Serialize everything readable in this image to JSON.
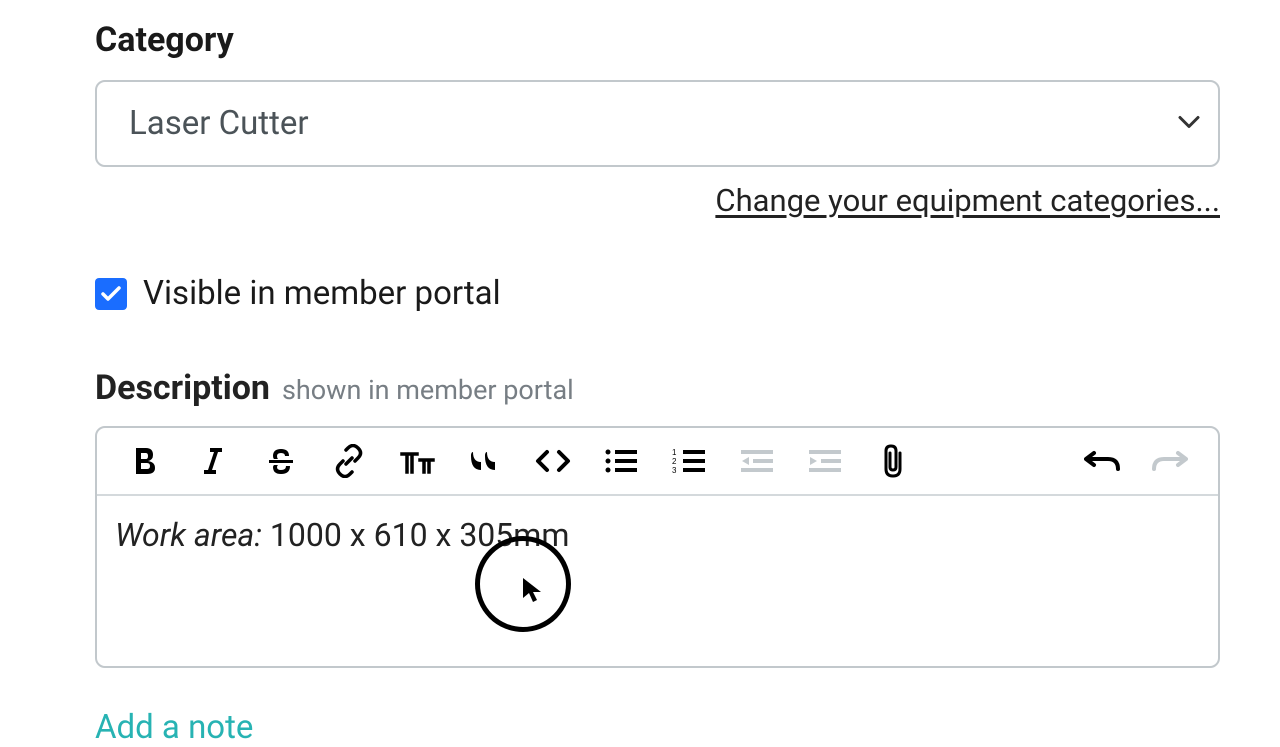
{
  "category": {
    "label": "Category",
    "value": "Laser Cutter",
    "change_link": "Change your equipment categories..."
  },
  "visibility": {
    "checked": true,
    "label": "Visible in member portal"
  },
  "description": {
    "label": "Description",
    "sublabel": "shown in member portal",
    "content_italic": "Work area:",
    "content_rest": " 1000 x 610 x 305mm"
  },
  "add_note": "Add a note"
}
